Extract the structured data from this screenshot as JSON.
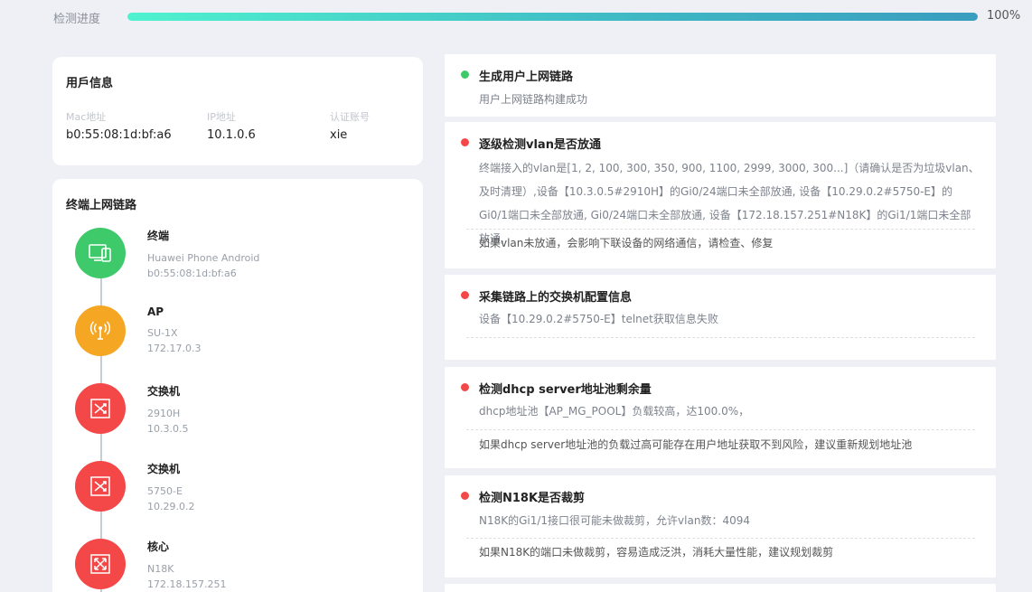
{
  "progress": {
    "label": "检测进度",
    "percent_text": "100%",
    "fraction": 1.0
  },
  "colors": {
    "green": "#3ec96a",
    "orange": "#f5a623",
    "red": "#f44848"
  },
  "user_info": {
    "title": "用戶信息",
    "fields": [
      {
        "label": "Mac地址",
        "value": "b0:55:08:1d:bf:a6"
      },
      {
        "label": "IP地址",
        "value": "10.1.0.6"
      },
      {
        "label": "认证账号",
        "value": "xie"
      }
    ]
  },
  "chain": {
    "title": "终端上网链路",
    "nodes": [
      {
        "name": "终端",
        "line1": "Huawei Phone Android",
        "line2": "b0:55:08:1d:bf:a6",
        "icon": "terminal-icon",
        "color": "green"
      },
      {
        "name": "AP",
        "line1": "SU-1X",
        "line2": "172.17.0.3",
        "icon": "ap-icon",
        "color": "orange"
      },
      {
        "name": "交换机",
        "line1": "2910H",
        "line2": "10.3.0.5",
        "icon": "switch-icon",
        "color": "red"
      },
      {
        "name": "交换机",
        "line1": "5750-E",
        "line2": "10.29.0.2",
        "icon": "switch-icon",
        "color": "red"
      },
      {
        "name": "核心",
        "line1": "N18K",
        "line2": "172.18.157.251",
        "icon": "core-icon",
        "color": "red"
      }
    ]
  },
  "results": [
    {
      "title": "生成用户上网链路",
      "status": "green",
      "desc": "用户上网链路构建成功",
      "advice": ""
    },
    {
      "title": "逐级检测vlan是否放通",
      "status": "red",
      "desc": "终端接入的vlan是[1, 2, 100, 300, 350, 900, 1100, 2999, 3000, 300...]（请确认是否为垃圾vlan、及时清理）,设备【10.3.0.5#2910H】的Gi0/24端口未全部放通, 设备【10.29.0.2#5750-E】的Gi0/1端口未全部放通, Gi0/24端口未全部放通, 设备【172.18.157.251#N18K】的Gi1/1端口未全部放通,",
      "advice": "如果vlan未放通，会影响下联设备的网络通信，请检查、修复"
    },
    {
      "title": "采集链路上的交换机配置信息",
      "status": "red",
      "desc": "设备【10.29.0.2#5750-E】telnet获取信息失败",
      "advice": ""
    },
    {
      "title": "检测dhcp server地址池剩余量",
      "status": "red",
      "desc": "dhcp地址池【AP_MG_POOL】负载较高，达100.0%，",
      "advice": "如果dhcp server地址池的负载过高可能存在用户地址获取不到风险，建议重新规划地址池"
    },
    {
      "title": "检测N18K是否裁剪",
      "status": "red",
      "desc": "N18K的Gi1/1接口很可能未做裁剪，允许vlan数：4094",
      "advice": "如果N18K的端口未做裁剪，容易造成泛洪，消耗大量性能，建议规划裁剪"
    }
  ]
}
